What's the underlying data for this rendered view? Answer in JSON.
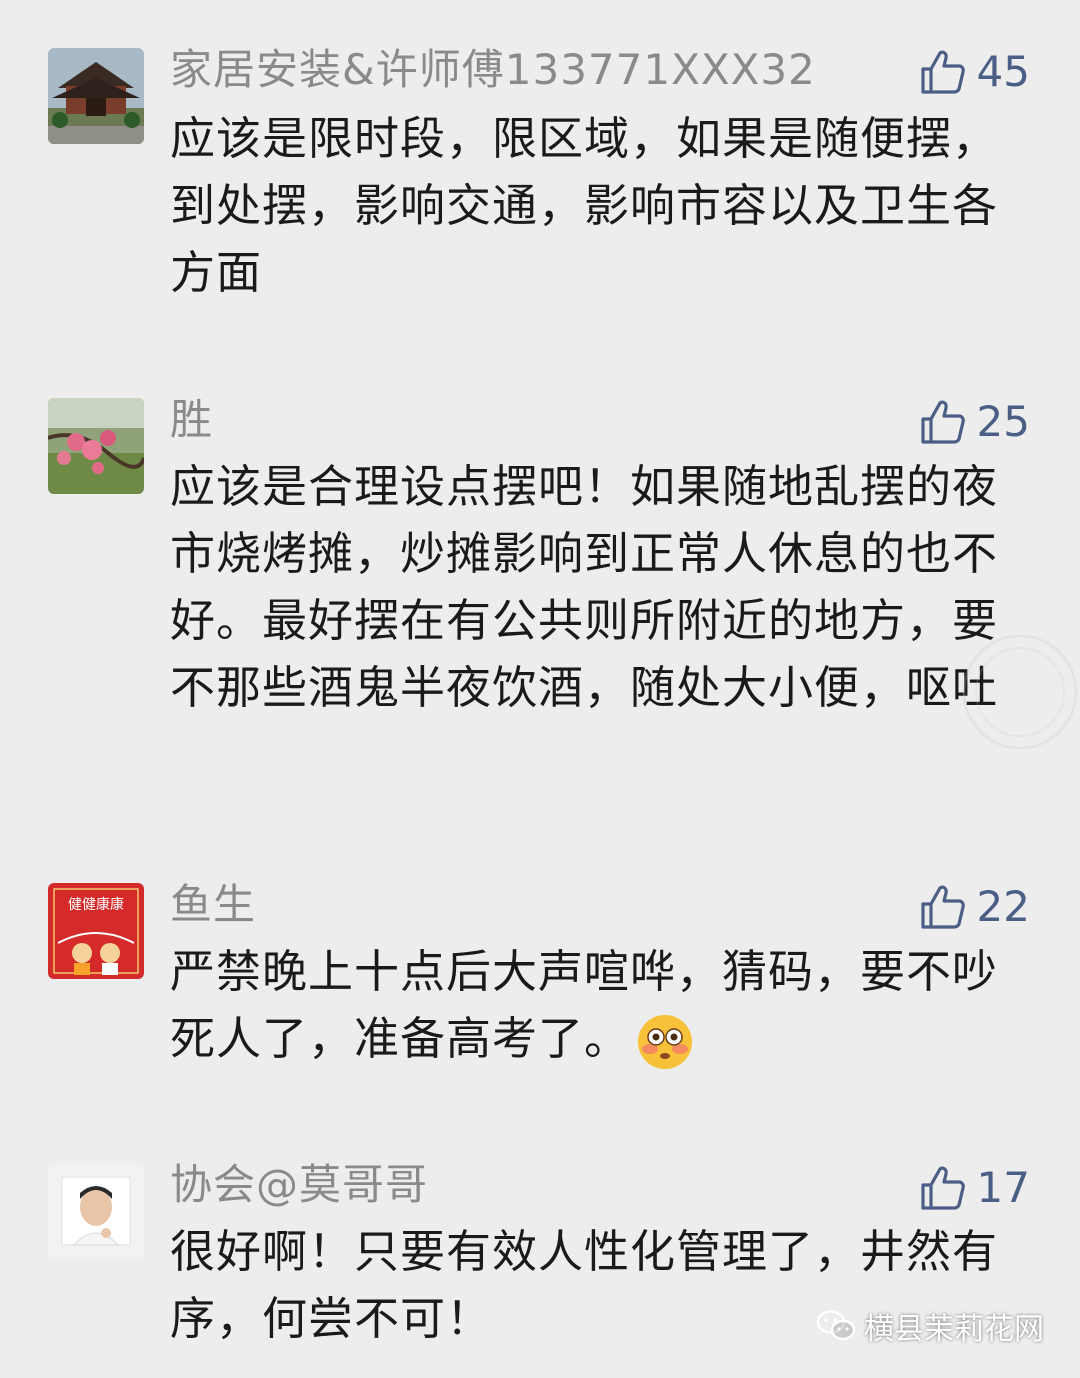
{
  "comments": [
    {
      "username": "家居安装&许师傅133771XXX32",
      "likes": "45",
      "text": "应该是限时段，限区域，如果是随便摆，到处摆，影响交通，影响市容以及卫生各方面",
      "avatar": "building-photo"
    },
    {
      "username": "胜",
      "likes": "25",
      "text": "应该是合理设点摆吧！如果随地乱摆的夜市烧烤摊，炒摊影响到正常人休息的也不好。最好摆在有公共则所附近的地方，要不那些酒鬼半夜饮酒，随处大小便，呕吐",
      "avatar": "flower-photo"
    },
    {
      "username": "鱼生",
      "likes": "22",
      "text": "严禁晚上十点后大声喧哗，猜码，要不吵死人了，准备高考了。",
      "emoji": "flushed-face-emoji",
      "avatar": "red-card-image",
      "avatar_text": "健健康康"
    },
    {
      "username": "协会@莫哥哥",
      "likes": "17",
      "text": "很好啊！只要有效人性化管理了，井然有序，何尝不可！",
      "avatar": "person-photo"
    }
  ],
  "watermark": {
    "label": "横县茉莉花网",
    "icon": "wechat-icon"
  },
  "colors": {
    "background": "#ededed",
    "username": "#8a8a8a",
    "like_accent": "#4b5e86",
    "text": "#1a1a1a"
  }
}
